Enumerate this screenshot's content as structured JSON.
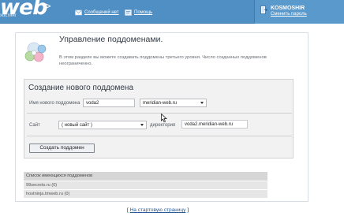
{
  "header": {
    "logo_text": "web",
    "logo_subtext": "хостинг",
    "messages_label": "Сообщений нет",
    "help_label": "Помощь",
    "user_name": "KOSMOSHIR",
    "change_password_label": "Сменить пароль"
  },
  "page": {
    "title": "Управление поддоменами.",
    "description": "В этом разделе вы можете создавать поддомены третьего уровня. Число созданных поддоменов неограниченно."
  },
  "form": {
    "title": "Создание нового поддомена",
    "name_label": "Имя нового поддомена",
    "name_value": "voda2",
    "domain_value": "meridian-web.ru",
    "site_label": "Сайт",
    "site_value": "( новый сайт )",
    "directory_label": "директория",
    "directory_value": "voda2.meridian-web.ru",
    "submit_label": "Создать поддомен"
  },
  "list": {
    "header": "Список имеющихся поддоменов",
    "items": [
      "99secrets.ru (0)",
      "hostninja.tmweb.ru (0)"
    ]
  },
  "footer": {
    "home_link_label": "На стартовую страницу",
    "bracket_open": "[",
    "bracket_close": "]"
  },
  "colors": {
    "header_bg": "#4f8fc4",
    "panel_border": "#d8dde3",
    "form_bg": "#f2f2f2",
    "list_header_bg": "#d6d6d6"
  }
}
